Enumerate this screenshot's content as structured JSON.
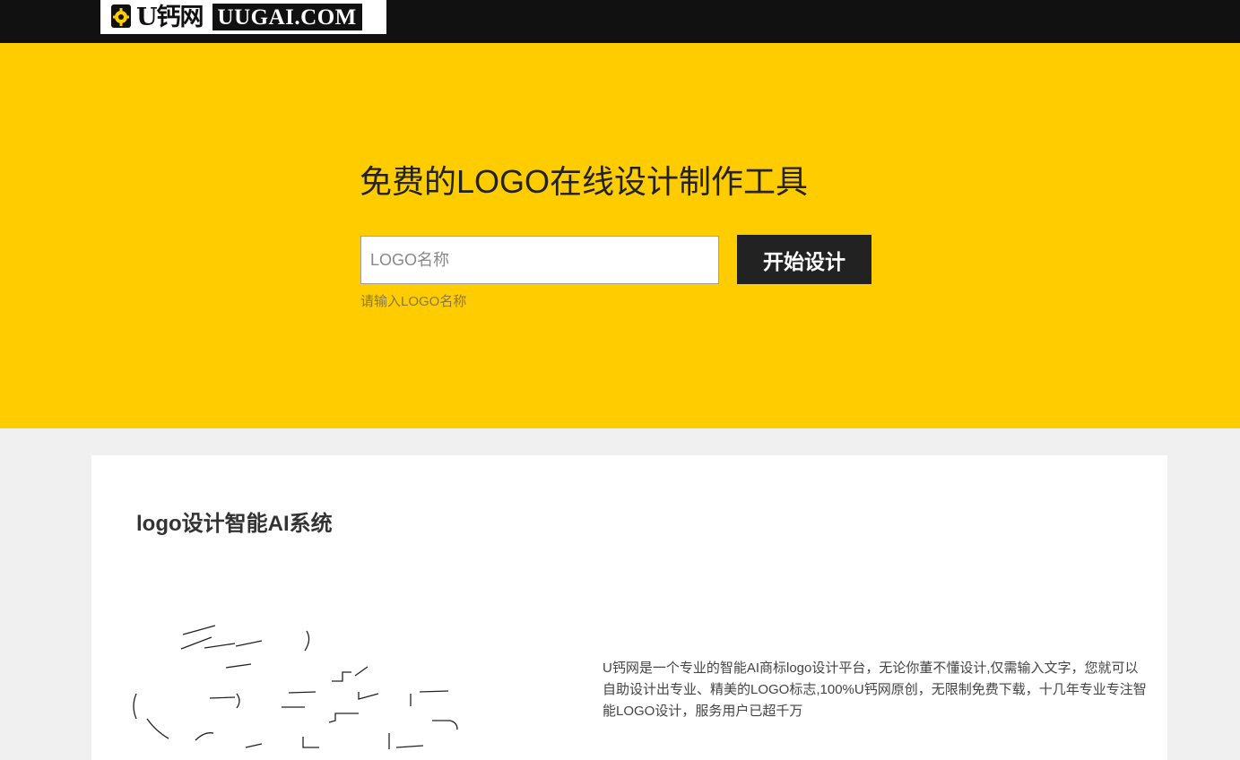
{
  "header": {
    "logo_cn": "U钙网",
    "logo_en": "UUGAI.COM",
    "logo_emblem_letter": "U",
    "logo_emblem_icon": "gear-icon",
    "bg_color": "#111111"
  },
  "hero": {
    "title": "免费的LOGO在线设计制作工具",
    "input_placeholder": "LOGO名称",
    "input_value": "",
    "start_button": "开始设计",
    "hint": "请输入LOGO名称",
    "bg_color": "#ffcc00"
  },
  "intro": {
    "title": "logo设计智能AI系统",
    "description": "U钙网是一个专业的智能AI商标logo设计平台，无论你董不懂设计,仅需输入文字，您就可以自助设计出专业、精美的LOGO标志,100%U钙网原创，无限制免费下载，十几年专业专注智能LOGO设计，服务用户已超千万"
  }
}
